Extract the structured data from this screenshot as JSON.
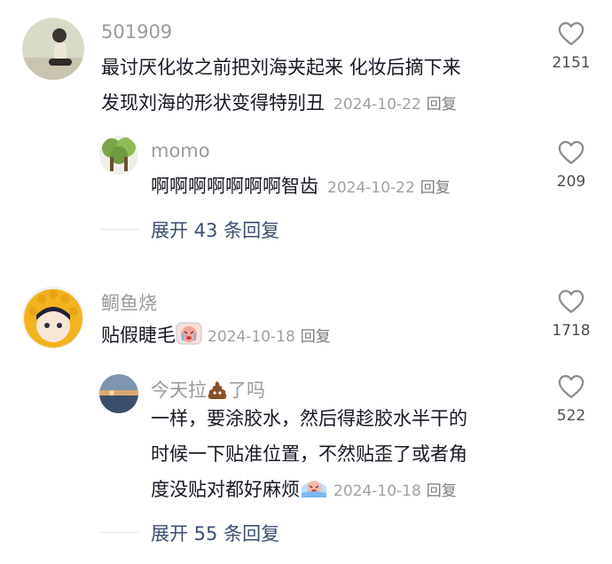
{
  "comments": [
    {
      "username": "501909",
      "lines": [
        "最讨厌化妆之前把刘海夹起来 化妆后摘下来",
        "发现刘海的形状变得特别丑"
      ],
      "date": "2024-10-22",
      "reply_label": "回复",
      "likes": "2151",
      "replies": [
        {
          "username": "momo",
          "text": "啊啊啊啊啊啊啊智齿",
          "date": "2024-10-22",
          "reply_label": "回复",
          "likes": "209"
        }
      ],
      "expand_label": "展开 43 条回复"
    },
    {
      "username": "鲷鱼烧",
      "text": "贴假睫毛",
      "emoji": "crying-face-sticker",
      "date": "2024-10-18",
      "reply_label": "回复",
      "likes": "1718",
      "replies": [
        {
          "username": "今天拉",
          "username_emoji": "poop-emoji",
          "username_suffix": "了吗",
          "lines": [
            "一样，要涂胶水，然后得趁胶水半干的",
            "时候一下贴准位置，不然贴歪了或者角",
            "度没贴对都好麻烦"
          ],
          "emoji": "crying-face-sticker",
          "date": "2024-10-18",
          "reply_label": "回复",
          "likes": "522"
        }
      ],
      "expand_label": "展开 55 条回复"
    }
  ],
  "colors": {
    "text": "#161823",
    "muted": "#9a9a9f",
    "link": "#3b4e72",
    "heart": "#8a8a90"
  }
}
